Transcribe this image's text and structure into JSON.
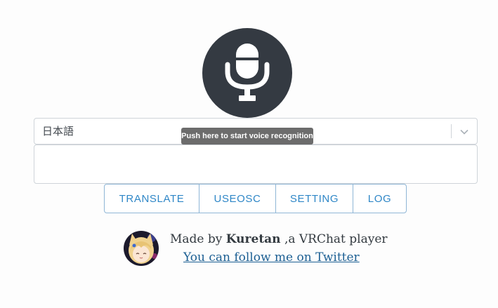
{
  "mic": {
    "icon": "microphone-icon"
  },
  "language_select": {
    "selected": "日本語",
    "icon": "chevron-down-icon"
  },
  "tooltip": {
    "text": "Push here to start voice recognition"
  },
  "output": {
    "value": "",
    "placeholder": ""
  },
  "buttons": {
    "translate": "TRANSLATE",
    "useosc": "USEOSC",
    "setting": "SETTING",
    "log": "LOG"
  },
  "credit": {
    "prefix": "Made by ",
    "author": "Kuretan",
    "suffix": " ,a VRChat player",
    "link_text": "You can follow me on Twitter"
  },
  "colors": {
    "mic_bg": "#343a42",
    "accent": "#2f87c7",
    "link": "#1c5f93",
    "tooltip_bg": "#6c6c6c"
  }
}
